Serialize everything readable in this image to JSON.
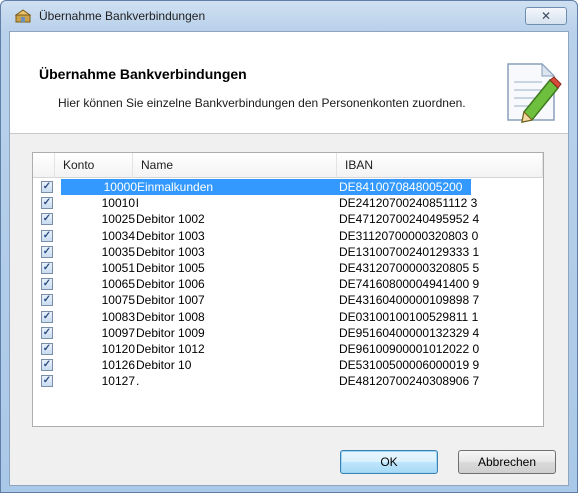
{
  "window": {
    "title": "Übernahme Bankverbindungen",
    "close_symbol": "✕"
  },
  "header": {
    "title": "Übernahme Bankverbindungen",
    "description": "Hier können Sie einzelne Bankverbindungen den Personenkonten zuordnen.",
    "icon": "document-edit-icon"
  },
  "list": {
    "columns": [
      "Konto",
      "Name",
      "IBAN"
    ],
    "rows": [
      {
        "checked": true,
        "konto": "10000",
        "name": "Einmalkunden",
        "iban": "DE8410070848005200",
        "selected": true
      },
      {
        "checked": true,
        "konto": "10010",
        "name": "l",
        "iban": "DE24120700240851112 3"
      },
      {
        "checked": true,
        "konto": "10025",
        "name": "Debitor 1002",
        "iban": "DE47120700240495952 4"
      },
      {
        "checked": true,
        "konto": "10034",
        "name": "Debitor 1003",
        "iban": "DE31120700000320803 0"
      },
      {
        "checked": true,
        "konto": "10035",
        "name": "Debitor 1003",
        "iban": "DE13100700240129333 1"
      },
      {
        "checked": true,
        "konto": "10051",
        "name": "Debitor 1005",
        "iban": "DE43120700000320805 5"
      },
      {
        "checked": true,
        "konto": "10065",
        "name": "Debitor 1006",
        "iban": "DE74160800004941400 9"
      },
      {
        "checked": true,
        "konto": "10075",
        "name": "Debitor 1007",
        "iban": "DE43160400000109898 7"
      },
      {
        "checked": true,
        "konto": "10083",
        "name": "Debitor 1008",
        "iban": "DE03100100100529811 1"
      },
      {
        "checked": true,
        "konto": "10097",
        "name": "Debitor 1009",
        "iban": "DE95160400000132329 4"
      },
      {
        "checked": true,
        "konto": "10120",
        "name": "Debitor 1012",
        "iban": "DE96100900001012022 0"
      },
      {
        "checked": true,
        "konto": "10126",
        "name": "Debitor 10",
        "iban": "DE53100500006000019 9"
      },
      {
        "checked": true,
        "konto": "10127",
        "name": ".",
        "iban": "DE48120700240308906 7"
      }
    ]
  },
  "buttons": {
    "ok": "OK",
    "cancel": "Abbrechen"
  }
}
